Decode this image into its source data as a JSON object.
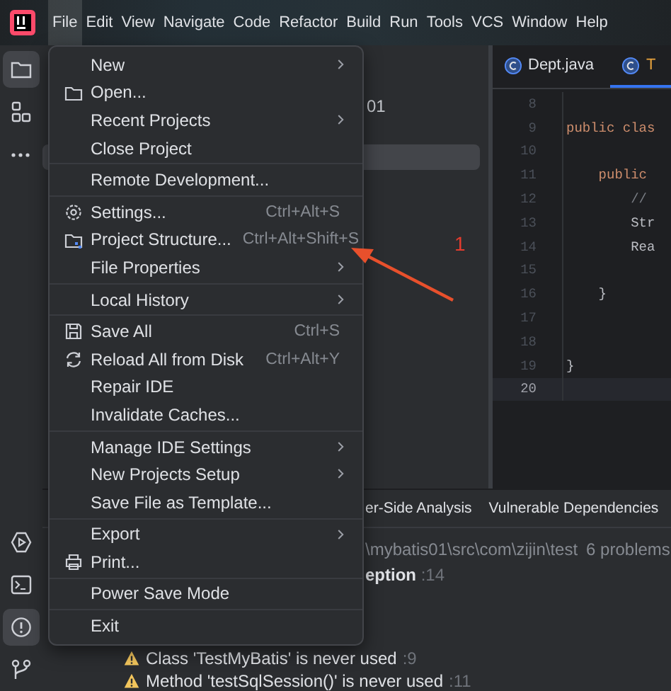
{
  "menubar": [
    {
      "label": "File",
      "selected": true
    },
    {
      "label": "Edit",
      "selected": false
    },
    {
      "label": "View",
      "selected": false
    },
    {
      "label": "Navigate",
      "selected": false
    },
    {
      "label": "Code",
      "selected": false
    },
    {
      "label": "Refactor",
      "selected": false
    },
    {
      "label": "Build",
      "selected": false
    },
    {
      "label": "Run",
      "selected": false
    },
    {
      "label": "Tools",
      "selected": false
    },
    {
      "label": "VCS",
      "selected": false
    },
    {
      "label": "Window",
      "selected": false
    },
    {
      "label": "Help",
      "selected": false
    }
  ],
  "tool_strip": {
    "top": [
      {
        "selected": true
      },
      {
        "selected": false
      },
      {
        "selected": false
      }
    ],
    "bottom": [
      {
        "selected": false
      },
      {
        "selected": false
      },
      {
        "selected": true
      },
      {
        "selected": false
      }
    ]
  },
  "project_tree": {
    "rows": [
      {
        "text": "01",
        "selected": false
      },
      {
        "selected": true
      }
    ]
  },
  "editor": {
    "tabs": [
      {
        "label": "Dept.java",
        "selected": false
      },
      {
        "label": "T",
        "selected": true
      }
    ],
    "lines": [
      {
        "number": "8",
        "current": false
      },
      {
        "number": "9",
        "text": "public clas",
        "kind": "keyword",
        "current": false
      },
      {
        "number": "10",
        "current": false
      },
      {
        "number": "11",
        "text": "    public",
        "kind": "keyword",
        "current": false
      },
      {
        "number": "12",
        "text": "        //",
        "kind": "comment",
        "current": false
      },
      {
        "number": "13",
        "text": "        Str",
        "kind": "plain",
        "current": false
      },
      {
        "number": "14",
        "text": "        Rea",
        "kind": "plain",
        "current": false
      },
      {
        "number": "15",
        "current": false
      },
      {
        "number": "16",
        "text": "    }",
        "kind": "plain",
        "current": false
      },
      {
        "number": "17",
        "current": false
      },
      {
        "number": "18",
        "current": false
      },
      {
        "number": "19",
        "text": "}",
        "kind": "plain",
        "current": false
      },
      {
        "number": "20",
        "current": true
      }
    ]
  },
  "problems": {
    "tabs": [
      {
        "label": "er-Side Analysis",
        "selected": false
      },
      {
        "label": "Vulnerable Dependencies",
        "selected": false
      }
    ],
    "path": "\\mybatis01\\src\\com\\zijin\\test",
    "count": "6 problems",
    "cut_item": {
      "text": "eption",
      "line": ":14"
    },
    "items": [
      {
        "text": "Class 'TestMyBatis' is never used",
        "line": ":9"
      },
      {
        "text": "Method 'testSqlSession()' is never used",
        "line": ":11"
      }
    ]
  },
  "file_menu": {
    "groups": [
      [
        {
          "label": "New",
          "submenu": true
        },
        {
          "label": "Open...",
          "submenu": false
        },
        {
          "label": "Recent Projects",
          "submenu": true
        },
        {
          "label": "Close Project",
          "submenu": false
        }
      ],
      [
        {
          "label": "Remote Development...",
          "submenu": false
        }
      ],
      [
        {
          "label": "Settings...",
          "shortcut": "Ctrl+Alt+S",
          "submenu": false
        },
        {
          "label": "Project Structure...",
          "shortcut": "Ctrl+Alt+Shift+S",
          "submenu": false
        },
        {
          "label": "File Properties",
          "submenu": true
        }
      ],
      [
        {
          "label": "Local History",
          "submenu": true
        }
      ],
      [
        {
          "label": "Save All",
          "shortcut": "Ctrl+S",
          "submenu": false
        },
        {
          "label": "Reload All from Disk",
          "shortcut": "Ctrl+Alt+Y",
          "submenu": false
        },
        {
          "label": "Repair IDE",
          "submenu": false
        },
        {
          "label": "Invalidate Caches...",
          "submenu": false
        }
      ],
      [
        {
          "label": "Manage IDE Settings",
          "submenu": true
        },
        {
          "label": "New Projects Setup",
          "submenu": true
        },
        {
          "label": "Save File as Template...",
          "submenu": false
        }
      ],
      [
        {
          "label": "Export",
          "submenu": true
        },
        {
          "label": "Print...",
          "submenu": false
        }
      ],
      [
        {
          "label": "Power Save Mode",
          "submenu": false
        }
      ],
      [
        {
          "label": "Exit",
          "submenu": false
        }
      ]
    ]
  },
  "annotation": {
    "label": "1"
  }
}
